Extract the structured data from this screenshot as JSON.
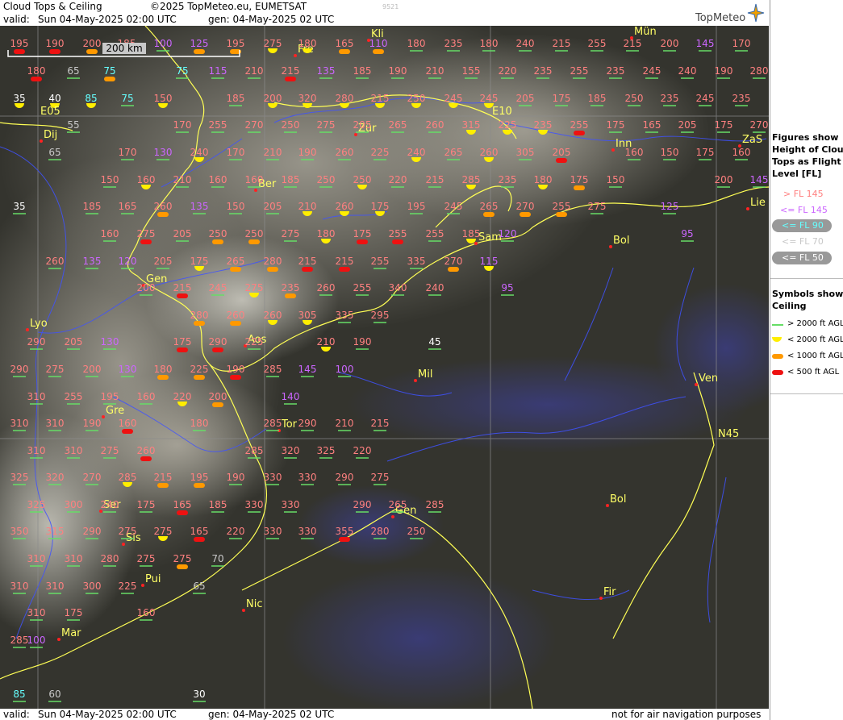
{
  "header": {
    "title": "Cloud Tops & Ceiling",
    "copyright": "©2025 TopMeteo.eu, EUMETSAT",
    "code": "9521",
    "valid_label": "valid:",
    "valid_value": "Sun  04-May-2025  02:00 UTC",
    "gen": "gen: 04-May-2025 02 UTC",
    "brand": "TopMeteo"
  },
  "footer": {
    "valid_label": "valid:",
    "valid_value": "Sun  04-May-2025  02:00 UTC",
    "gen": "gen: 04-May-2025 02 UTC",
    "note": "not for air navigation purposes"
  },
  "scale": {
    "label": "200 km"
  },
  "legend": {
    "figures_title": [
      "Figures show",
      "Height of Cloud",
      "Tops as Flight",
      "Level  [FL]"
    ],
    "levels": [
      {
        "label": "> FL 145",
        "color": "#ff8080"
      },
      {
        "label": "<= FL 145",
        "color": "#cc66ff"
      },
      {
        "label": "<= FL 90",
        "color": "#66ffff"
      },
      {
        "label": "<= FL 70",
        "color": "#c8c8c8"
      },
      {
        "label": "<= FL 50",
        "color": "#ffffff"
      }
    ],
    "symbols_title": [
      "Symbols show",
      "Ceiling"
    ],
    "symbols": [
      {
        "label": "> 2000 ft AGL",
        "kind": "line",
        "color": "#66dd66"
      },
      {
        "label": "< 2000 ft AGL",
        "kind": "yellow",
        "color": "#ffee00"
      },
      {
        "label": "< 1000 ft AGL",
        "kind": "orange",
        "color": "#ff9900"
      },
      {
        "label": "< 500 ft AGL",
        "kind": "red",
        "color": "#ee1111"
      }
    ]
  },
  "grid_labels": [
    "E05",
    "E10",
    "N45"
  ],
  "cities": [
    "Dij",
    "Fre",
    "Kli",
    "Mün",
    "Zür",
    "Inn",
    "ZaS",
    "Lie",
    "Ber",
    "Sam",
    "Bol",
    "Gen",
    "Lyo",
    "Aos",
    "Mil",
    "Ven",
    "Gre",
    "Tor",
    "Ser",
    "Gen",
    "Bol",
    "Sis",
    "Pui",
    "Nic",
    "Fir",
    "Mar"
  ],
  "rows": [
    "195r 190r 200o 185o 100p 125o 195o 275y 180y 165o 110o 180 235 180 240 215 255 215 200 145p 170",
    "180r 65 75o 75c 115 210 215r 135p 185 190 210 155 220 235 255 235 245 240 190 280",
    "35y 40y 85y 75c 150y 185 200y 320y 280y 215y 250y 245y 245y 205 175 185 250 235 245 235",
    "55 170 255 270 250 275 205 265 260 315y 225y 235y 255r 175 165 205 175 270",
    "65 170 130p 240y 170 210 190 260 225 240y 265 260y 305 205r 160 150 175 160",
    "150 160y 210 160 160 185 250 250y 220 215 285y 235 180y 175o 150 200 145p",
    "35 185 165 260o 135p 150 205 210y 260y 175y 195 245 265o 270o 255o 275 125p",
    "160 275r 205 250o 250o 275 180y 175r 255r 255 185y 120p 95p",
    "260 135p 120p 205 175y 265o 280o 215r 215r 255 335 270o 115y",
    "200 215r 245 275y 235o 260 255 340 240 95p",
    "280o 260o 260y 305y 335 295",
    "290 205 130p 175r 290r 225 210y 190 45",
    "290 275 200 130p 180o 225o 190r 285 145p 100p",
    "310 255 195 160 220y 200o 140p",
    "310 310 190 160r 180 285 290 210 215",
    "310 310 275 260r 285 320 325 220",
    "325 320 270 285y 215o 195o 190 330 330 290 275",
    "325 300 240 175 165r 185 330 330 290 265 285",
    "350 315 290 275 275y 165r 220 330 330 355r 280 250",
    "310 310 280 275 275o 70",
    "310 310 300 225 65",
    "310 175 160",
    "285 100p",
    "85c 60 30"
  ]
}
